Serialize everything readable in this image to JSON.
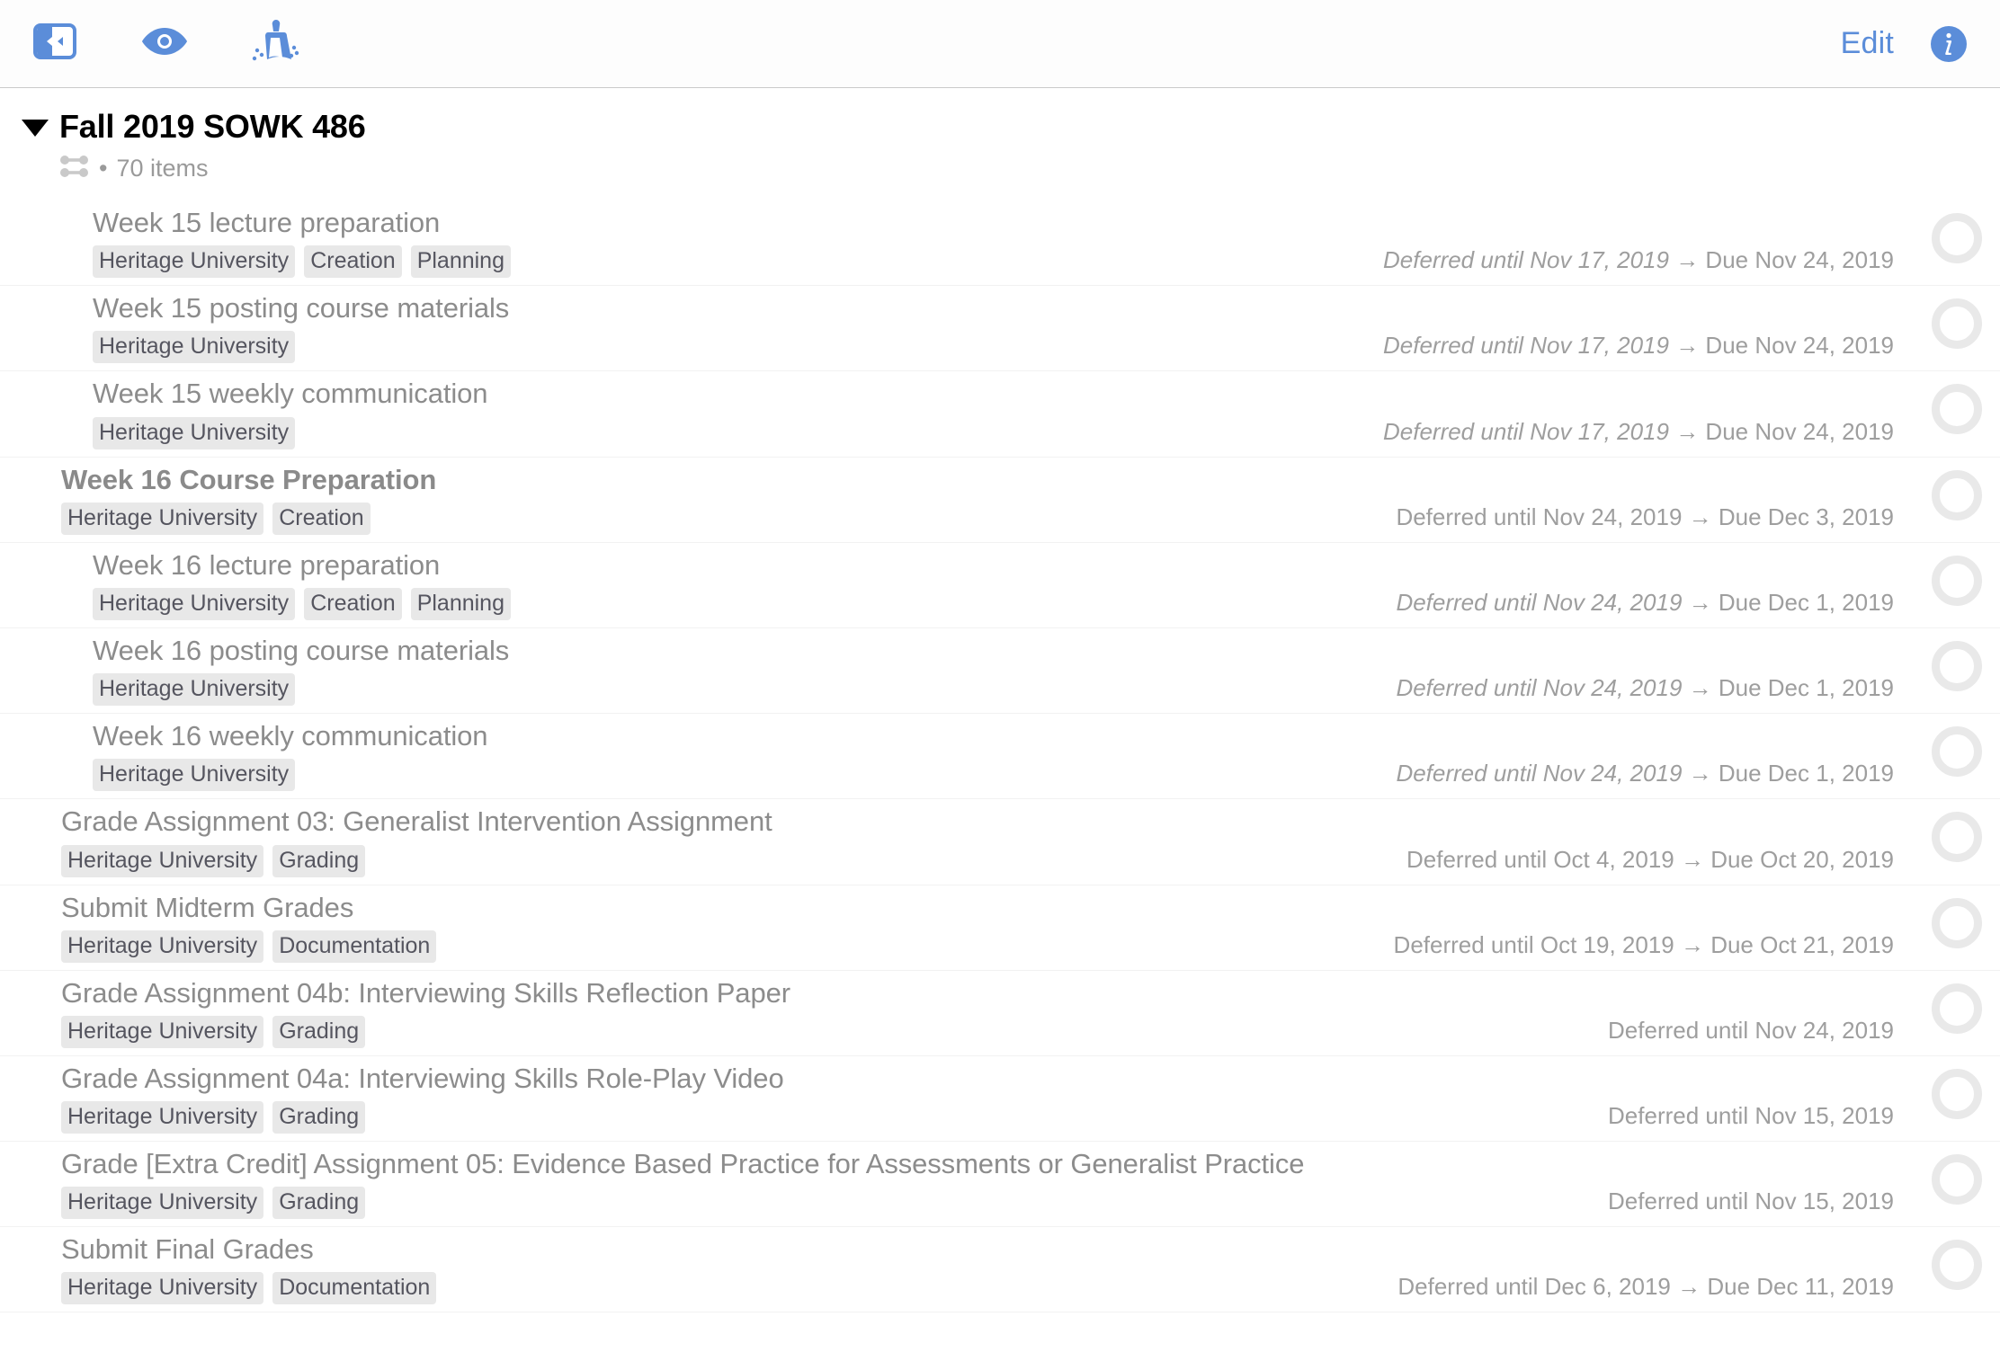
{
  "toolbar": {
    "left_buttons": [
      {
        "name": "sidebar-toggle-icon",
        "label": "Toggle Sidebar"
      },
      {
        "name": "eye-icon",
        "label": "View Options"
      },
      {
        "name": "broom-icon",
        "label": "Clean Up"
      }
    ],
    "edit_label": "Edit",
    "info_label": "Inspector"
  },
  "project": {
    "title": "Fall 2019 SOWK 486",
    "item_count_text": "70 items",
    "separator": "•",
    "order_icon": "parallel-icon",
    "expanded": true
  },
  "tasks": [
    {
      "title": "Week 15 lecture preparation",
      "tags": [
        "Heritage University",
        "Creation",
        "Planning"
      ],
      "deferred": "Deferred until Nov 17, 2019",
      "due": "→ Due Nov 24, 2019",
      "indent": 1,
      "is_project": false,
      "deferred_italic": true
    },
    {
      "title": "Week 15 posting course materials",
      "tags": [
        "Heritage University"
      ],
      "deferred": "Deferred until Nov 17, 2019",
      "due": "→ Due Nov 24, 2019",
      "indent": 1,
      "is_project": false,
      "deferred_italic": true
    },
    {
      "title": "Week 15 weekly communication",
      "tags": [
        "Heritage University"
      ],
      "deferred": "Deferred until Nov 17, 2019",
      "due": "→ Due Nov 24, 2019",
      "indent": 1,
      "is_project": false,
      "deferred_italic": true
    },
    {
      "title": "Week 16 Course Preparation",
      "tags": [
        "Heritage University",
        "Creation"
      ],
      "deferred": "Deferred until Nov 24, 2019",
      "due": "→ Due Dec 3, 2019",
      "indent": 0,
      "is_project": true,
      "deferred_italic": false
    },
    {
      "title": "Week 16 lecture preparation",
      "tags": [
        "Heritage University",
        "Creation",
        "Planning"
      ],
      "deferred": "Deferred until Nov 24, 2019",
      "due": "→ Due Dec 1, 2019",
      "indent": 1,
      "is_project": false,
      "deferred_italic": true
    },
    {
      "title": "Week 16 posting course materials",
      "tags": [
        "Heritage University"
      ],
      "deferred": "Deferred until Nov 24, 2019",
      "due": "→ Due Dec 1, 2019",
      "indent": 1,
      "is_project": false,
      "deferred_italic": true
    },
    {
      "title": "Week 16 weekly communication",
      "tags": [
        "Heritage University"
      ],
      "deferred": "Deferred until Nov 24, 2019",
      "due": "→ Due Dec 1, 2019",
      "indent": 1,
      "is_project": false,
      "deferred_italic": true
    },
    {
      "title": "Grade Assignment 03: Generalist Intervention Assignment",
      "tags": [
        "Heritage University",
        "Grading"
      ],
      "deferred": "Deferred until Oct 4, 2019",
      "due": "→ Due Oct 20, 2019",
      "indent": 0,
      "is_project": false,
      "deferred_italic": false
    },
    {
      "title": "Submit Midterm Grades",
      "tags": [
        "Heritage University",
        "Documentation"
      ],
      "deferred": "Deferred until Oct 19, 2019",
      "due": "→ Due Oct 21, 2019",
      "indent": 0,
      "is_project": false,
      "deferred_italic": false
    },
    {
      "title": "Grade Assignment 04b: Interviewing Skills Reflection Paper",
      "tags": [
        "Heritage University",
        "Grading"
      ],
      "deferred": "Deferred until Nov 24, 2019",
      "due": "",
      "indent": 0,
      "is_project": false,
      "deferred_italic": false
    },
    {
      "title": "Grade Assignment 04a: Interviewing Skills Role-Play Video",
      "tags": [
        "Heritage University",
        "Grading"
      ],
      "deferred": "Deferred until Nov 15, 2019",
      "due": "",
      "indent": 0,
      "is_project": false,
      "deferred_italic": false
    },
    {
      "title": "Grade [Extra Credit] Assignment 05: Evidence Based Practice for Assessments or Generalist Practice",
      "tags": [
        "Heritage University",
        "Grading"
      ],
      "deferred": "Deferred until Nov 15, 2019",
      "due": "",
      "indent": 0,
      "is_project": false,
      "deferred_italic": false
    },
    {
      "title": "Submit Final Grades",
      "tags": [
        "Heritage University",
        "Documentation"
      ],
      "deferred": "Deferred until Dec 6, 2019",
      "due": "→ Due Dec 11, 2019",
      "indent": 0,
      "is_project": false,
      "deferred_italic": false
    }
  ],
  "colors": {
    "accent": "#5b8dd9",
    "tag_bg": "#e8e8e8",
    "tag_text": "#55555f",
    "task_text": "#8c8c8c",
    "date_text": "#9e9e9e",
    "checkbox_ring": "#e9e9e9"
  }
}
